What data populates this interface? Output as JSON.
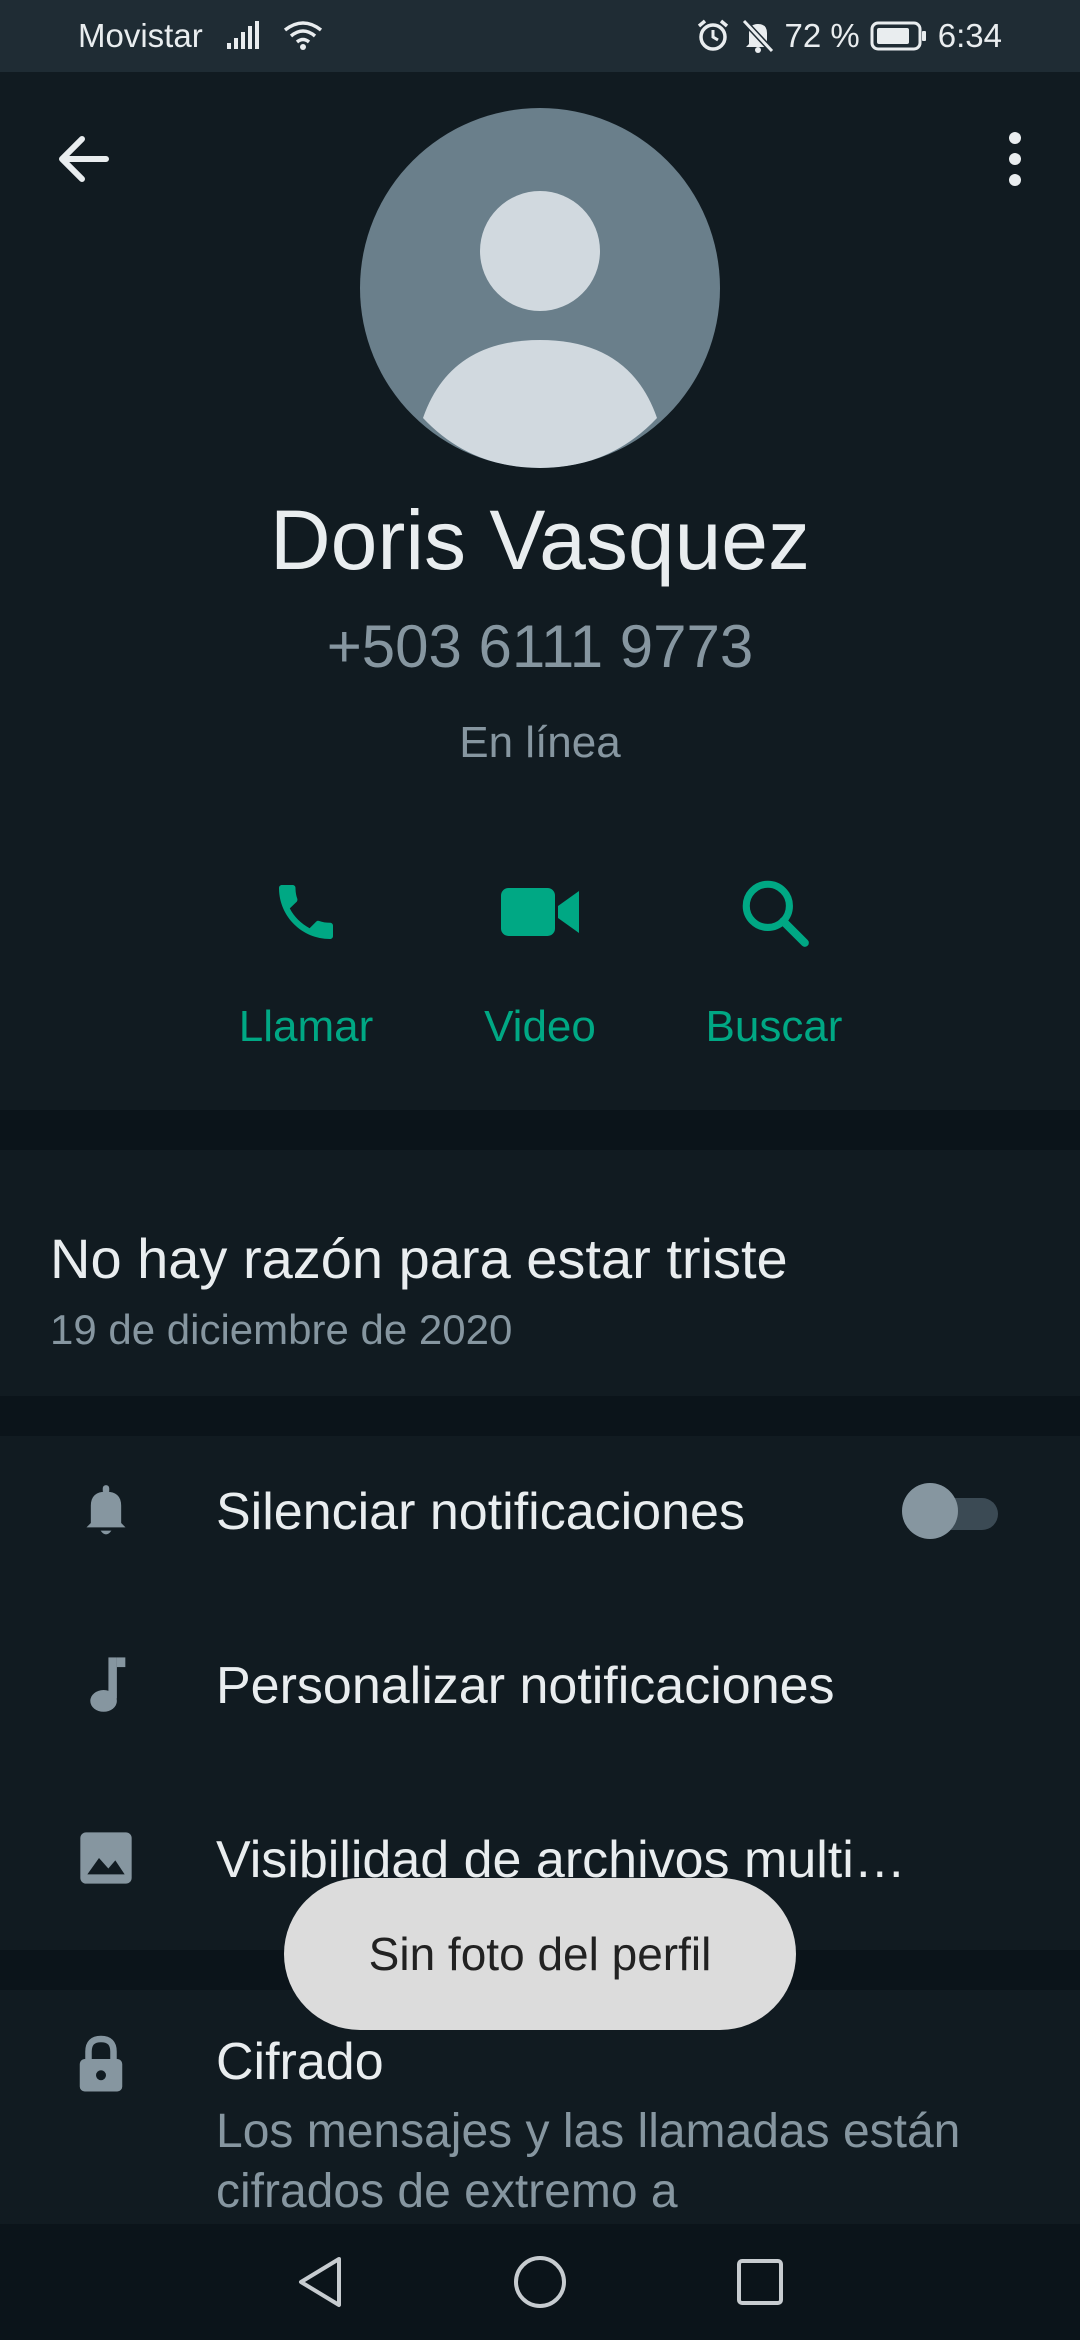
{
  "status_bar": {
    "carrier": "Movistar",
    "battery": "72 %",
    "time": "6:34"
  },
  "contact": {
    "name": "Doris Vasquez",
    "phone": "+503 6111 9773",
    "presence": "En línea"
  },
  "actions": {
    "call_label": "Llamar",
    "video_label": "Video",
    "search_label": "Buscar"
  },
  "about": {
    "text": "No hay razón para estar triste",
    "date": "19 de diciembre de 2020"
  },
  "settings": {
    "mute_label": "Silenciar notificaciones",
    "mute_enabled": false,
    "custom_label": "Personalizar notificaciones",
    "media_label": "Visibilidad de archivos multi…"
  },
  "encryption": {
    "title": "Cifrado",
    "description": "Los mensajes y las llamadas están cifrados de extremo a"
  },
  "toast": {
    "text": "Sin foto del perfil"
  },
  "colors": {
    "accent": "#00a884",
    "background": "#0b141a",
    "surface": "#111b21"
  }
}
